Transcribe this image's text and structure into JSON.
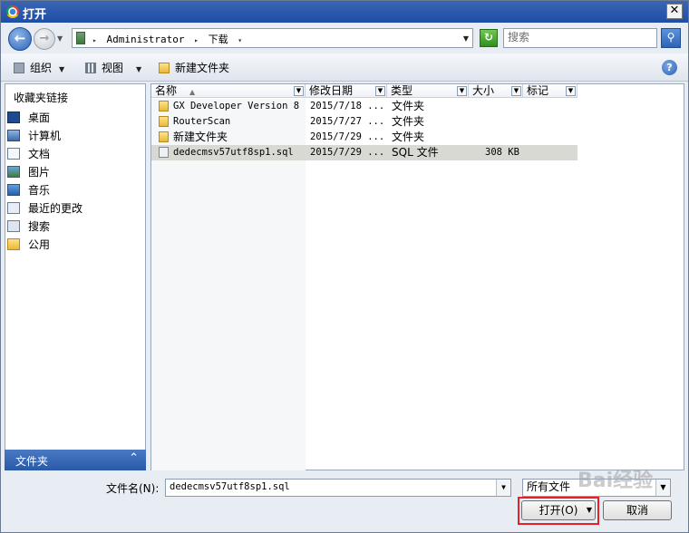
{
  "window": {
    "title": "打开",
    "close_symbol": "✕"
  },
  "address": {
    "breadcrumbs": [
      "Administrator",
      "下载"
    ],
    "search_placeholder": "搜索"
  },
  "toolbar": {
    "organize": "组织",
    "view": "视图",
    "new_folder": "新建文件夹",
    "help": "?"
  },
  "nav": {
    "heading": "收藏夹链接",
    "items": [
      {
        "label": "桌面",
        "icon": "desktop-icon"
      },
      {
        "label": "计算机",
        "icon": "computer-icon"
      },
      {
        "label": "文档",
        "icon": "documents-icon"
      },
      {
        "label": "图片",
        "icon": "pictures-icon"
      },
      {
        "label": "音乐",
        "icon": "music-icon"
      },
      {
        "label": "最近的更改",
        "icon": "recent-changes-icon"
      },
      {
        "label": "搜索",
        "icon": "search-icon"
      },
      {
        "label": "公用",
        "icon": "public-folder-icon"
      }
    ],
    "folders_bar": "文件夹",
    "folders_chevron": "⌃"
  },
  "columns": {
    "name": "名称",
    "date": "修改日期",
    "type": "类型",
    "size": "大小",
    "tags": "标记"
  },
  "files": [
    {
      "name": "GX Developer Version 8",
      "date": "2015/7/18 ...",
      "type": "文件夹",
      "size": "",
      "kind": "folder"
    },
    {
      "name": "RouterScan",
      "date": "2015/7/27 ...",
      "type": "文件夹",
      "size": "",
      "kind": "folder"
    },
    {
      "name": "新建文件夹",
      "date": "2015/7/29 ...",
      "type": "文件夹",
      "size": "",
      "kind": "folder"
    },
    {
      "name": "dedecmsv57utf8sp1.sql",
      "date": "2015/7/29 ...",
      "type": "SQL 文件",
      "size": "308 KB",
      "kind": "file"
    }
  ],
  "footer": {
    "filename_label": "文件名(N):",
    "filename_value": "dedecmsv57utf8sp1.sql",
    "filetype_value": "所有文件",
    "open_button": "打开(O)",
    "cancel_button": "取消",
    "watermark": "Bai经验"
  }
}
